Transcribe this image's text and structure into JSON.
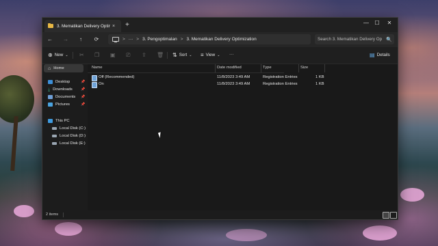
{
  "window": {
    "tab_title": "3. Mematikan Delivery Optimi",
    "new_tab": "+",
    "close_tab": "×",
    "controls": {
      "minimize": "—",
      "maximize": "☐",
      "close": "✕"
    }
  },
  "nav": {
    "back": "←",
    "forward": "→",
    "up": "↑",
    "refresh": "⟳"
  },
  "address": {
    "more": "···",
    "crumbs": [
      "3. Pengoptimalan",
      "3. Mematikan Delivery Optimization"
    ],
    "separator": ">"
  },
  "search": {
    "placeholder": "Search 3. Mematikan Delivery Op",
    "icon": "🔍"
  },
  "toolbar": {
    "new_label": "New",
    "sort_label": "Sort",
    "view_label": "View",
    "more_label": "···",
    "details_label": "Details"
  },
  "sidebar": {
    "home": "Home",
    "quick": [
      {
        "label": "Desktop",
        "color": "#3d8fd8"
      },
      {
        "label": "Downloads",
        "color": "#3bb88a"
      },
      {
        "label": "Documents",
        "color": "#6f9fd6"
      },
      {
        "label": "Pictures",
        "color": "#4aa3e0"
      }
    ],
    "this_pc": "This PC",
    "drives": [
      "Local Disk (C:)",
      "Local Disk (D:)",
      "Local Disk (E:)"
    ]
  },
  "columns": {
    "name": "Name",
    "date": "Date modified",
    "type": "Type",
    "size": "Size"
  },
  "files": [
    {
      "name": "Off (Recommended)",
      "date": "11/8/2023 3:49 AM",
      "type": "Registration Entries",
      "size": "1 KB"
    },
    {
      "name": "On",
      "date": "11/8/2023 3:49 AM",
      "type": "Registration Entries",
      "size": "1 KB"
    }
  ],
  "status": {
    "count": "2 items"
  }
}
